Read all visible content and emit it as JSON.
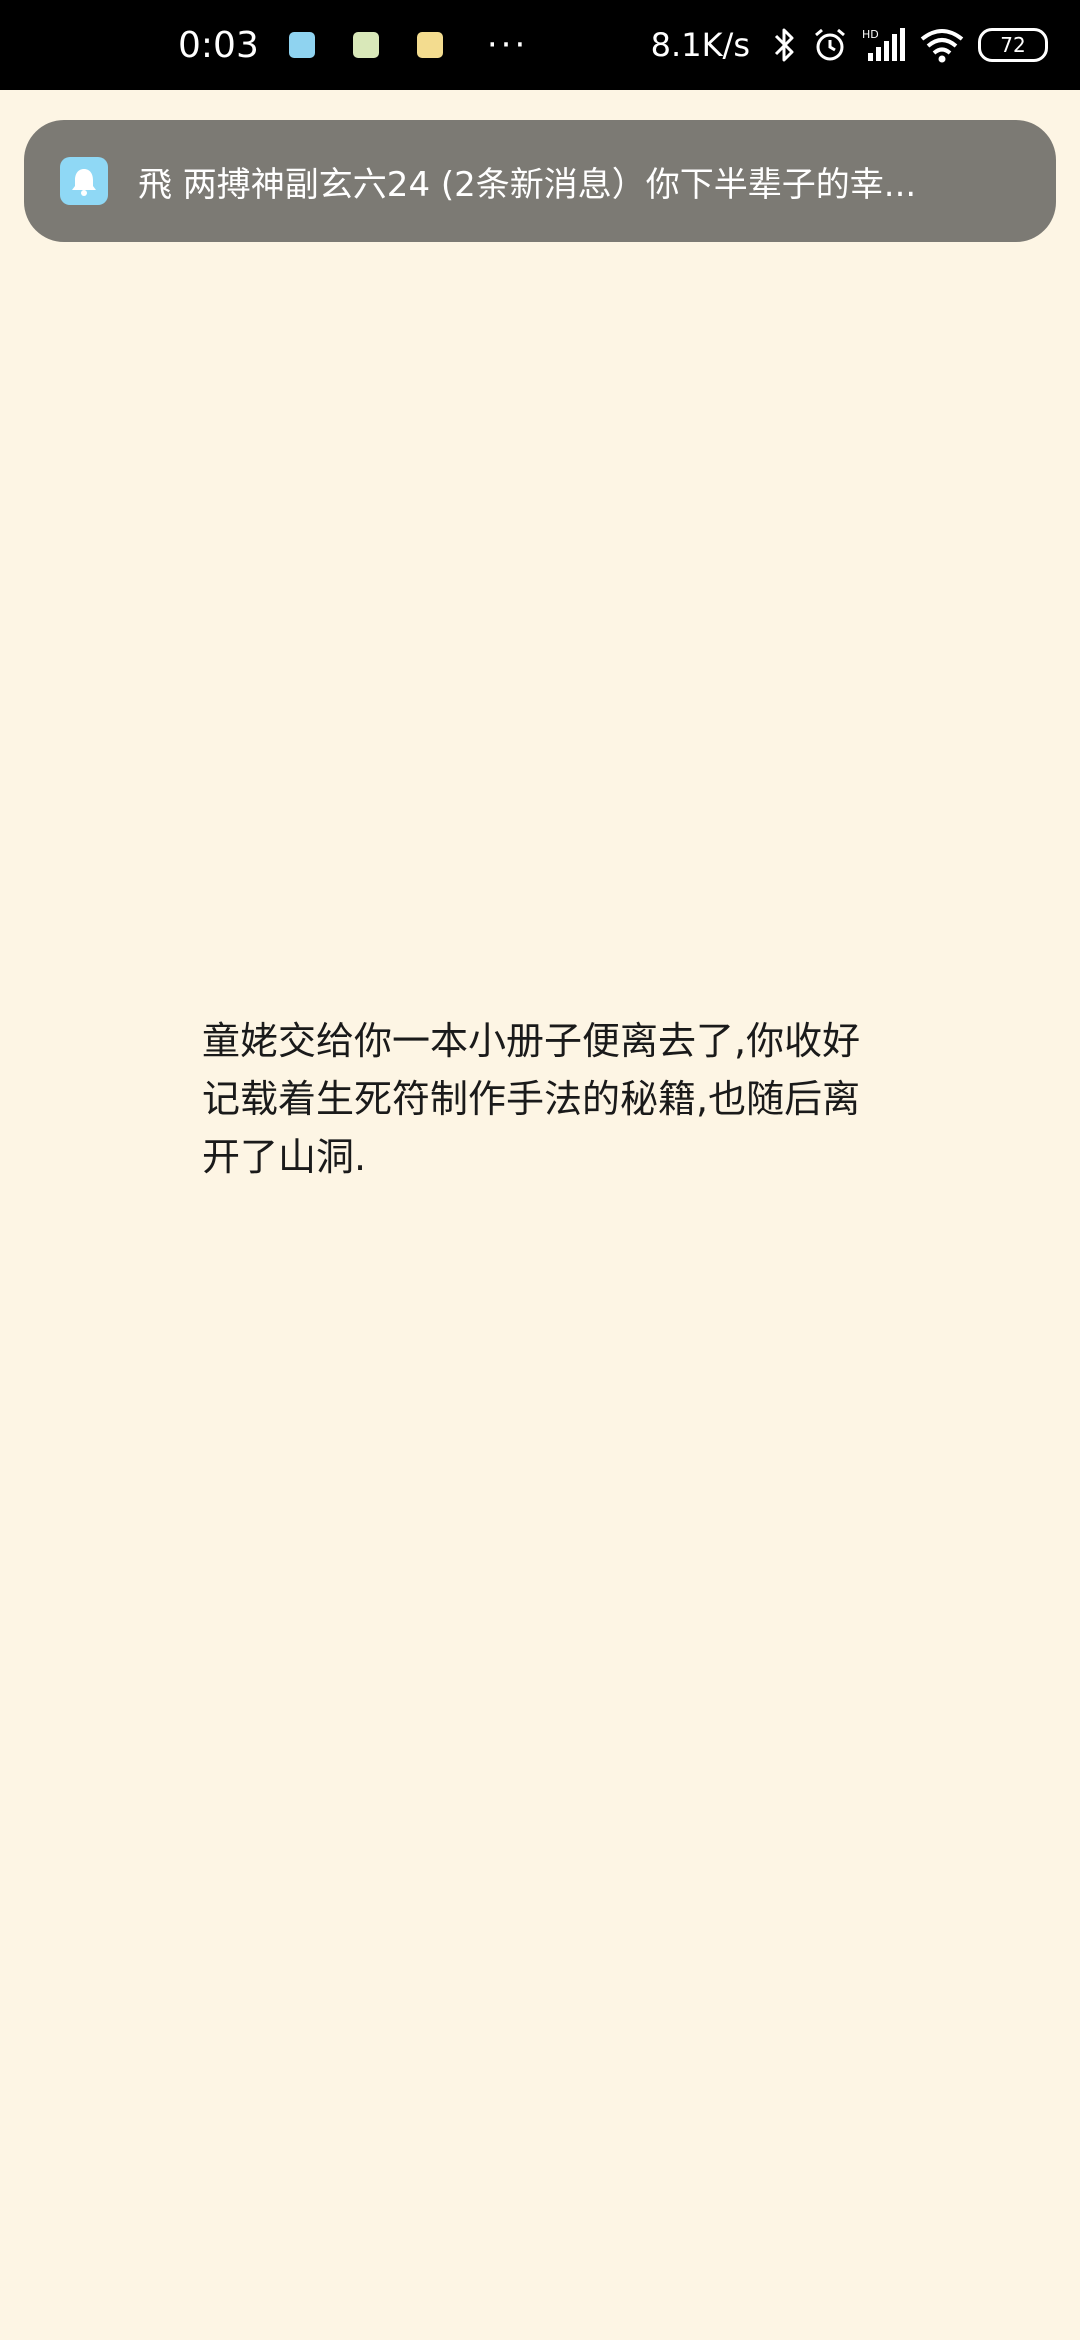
{
  "status_bar": {
    "time": "0:03",
    "dots": "···",
    "net_speed": "8.1K/s",
    "battery": "72",
    "app_icons": [
      "qq-icon",
      "app-green-icon",
      "app-yellow-icon"
    ],
    "status_icons": [
      "bluetooth-icon",
      "alarm-icon",
      "signal-hd-icon",
      "wifi-icon",
      "battery-icon"
    ]
  },
  "notification": {
    "icon": "qq-bell-icon",
    "text": "飛 两搏神副玄六24 (2条新消息）你下半辈子的幸..."
  },
  "story": {
    "text": "童姥交给你一本小册子便离去了,你收好记载着生死符制作手法的秘籍,也随后离开了山洞."
  },
  "colors": {
    "background": "#fdf5e4",
    "status_bar": "#000000",
    "notification_bg": "#7c7a74",
    "qq_blue": "#8fd8f5"
  }
}
